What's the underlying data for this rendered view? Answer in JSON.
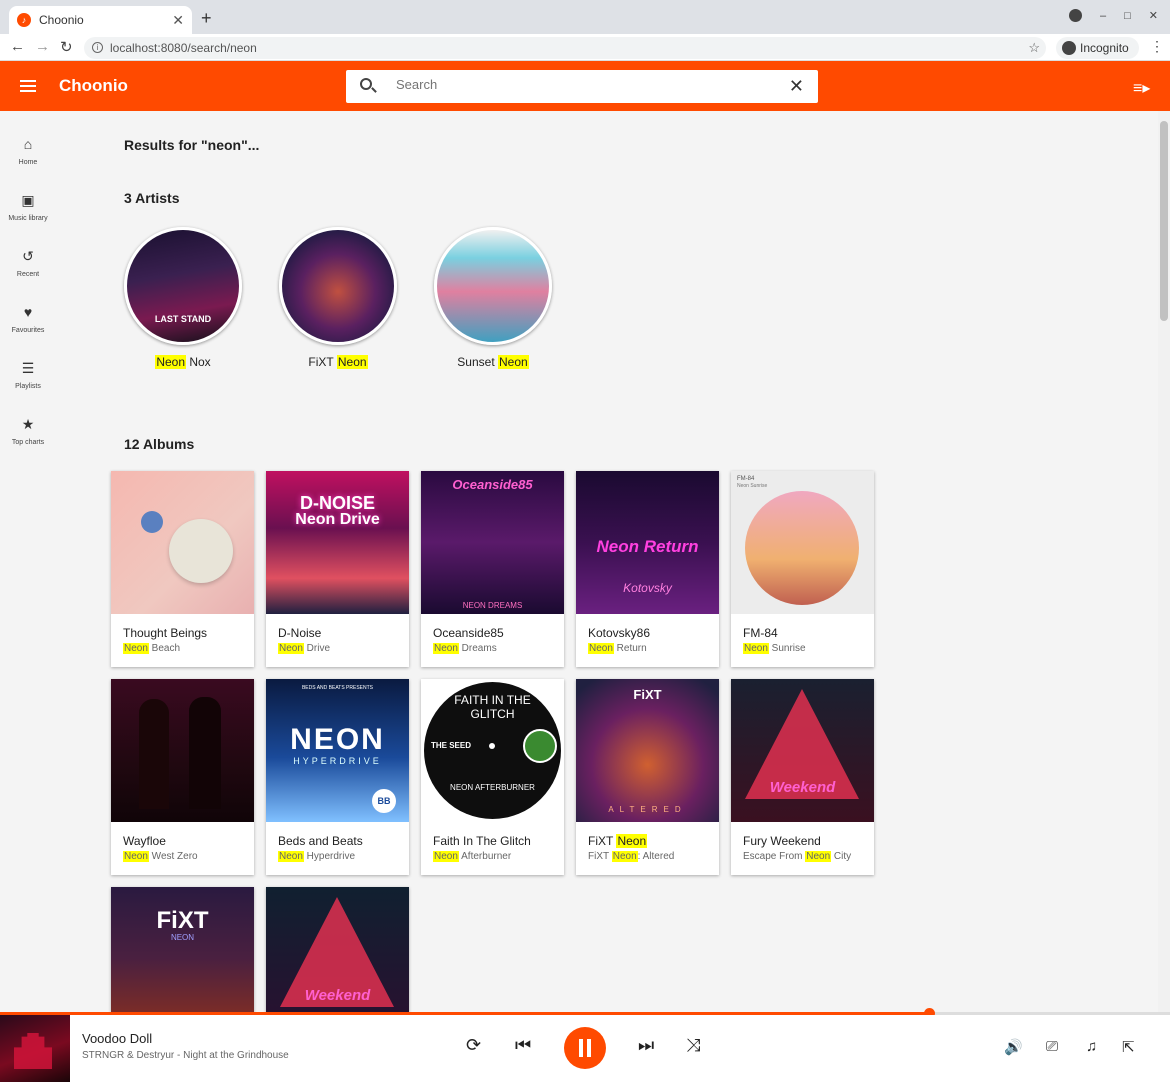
{
  "browser": {
    "tab_title": "Choonio",
    "new_tab": "+",
    "url": "localhost:8080/search/neon",
    "profile": "Incognito"
  },
  "app": {
    "brand": "Choonio",
    "search_placeholder": "Search",
    "accent": "#ff4a00"
  },
  "sidebar": {
    "items": [
      {
        "label": "Home",
        "icon": "home-icon",
        "glyph": "⌂"
      },
      {
        "label": "Music library",
        "icon": "library-icon",
        "glyph": "▣"
      },
      {
        "label": "Recent",
        "icon": "history-icon",
        "glyph": "↺"
      },
      {
        "label": "Favourites",
        "icon": "heart-icon",
        "glyph": "♥"
      },
      {
        "label": "Playlists",
        "icon": "list-icon",
        "glyph": "☰"
      },
      {
        "label": "Top charts",
        "icon": "star-icon",
        "glyph": "★"
      }
    ]
  },
  "search": {
    "results_title": "Results for \"neon\"...",
    "artists_title": "3 Artists",
    "albums_title": "12 Albums"
  },
  "artists": [
    {
      "pre": "",
      "hl": "Neon",
      "post": " Nox"
    },
    {
      "pre": "FiXT ",
      "hl": "Neon",
      "post": ""
    },
    {
      "pre": "Sunset ",
      "hl": "Neon",
      "post": ""
    }
  ],
  "albums": [
    {
      "artist_pre": "Thought Beings",
      "artist_hl": "",
      "artist_post": "",
      "title_pre": "",
      "title_hl": "Neon",
      "title_post": " Beach"
    },
    {
      "artist_pre": "D-Noise",
      "artist_hl": "",
      "artist_post": "",
      "title_pre": "",
      "title_hl": "Neon",
      "title_post": " Drive"
    },
    {
      "artist_pre": "Oceanside85",
      "artist_hl": "",
      "artist_post": "",
      "title_pre": "",
      "title_hl": "Neon",
      "title_post": " Dreams"
    },
    {
      "artist_pre": "Kotovsky86",
      "artist_hl": "",
      "artist_post": "",
      "title_pre": "",
      "title_hl": "Neon",
      "title_post": " Return"
    },
    {
      "artist_pre": "FM-84",
      "artist_hl": "",
      "artist_post": "",
      "title_pre": "",
      "title_hl": "Neon",
      "title_post": " Sunrise"
    },
    {
      "artist_pre": "Wayfloe",
      "artist_hl": "",
      "artist_post": "",
      "title_pre": "",
      "title_hl": "Neon",
      "title_post": " West Zero"
    },
    {
      "artist_pre": "Beds and Beats",
      "artist_hl": "",
      "artist_post": "",
      "title_pre": "",
      "title_hl": "Neon",
      "title_post": " Hyperdrive"
    },
    {
      "artist_pre": "Faith In The Glitch",
      "artist_hl": "",
      "artist_post": "",
      "title_pre": "",
      "title_hl": "Neon",
      "title_post": " Afterburner"
    },
    {
      "artist_pre": "FiXT ",
      "artist_hl": "Neon",
      "artist_post": "",
      "title_pre": "FiXT ",
      "title_hl": "Neon",
      "title_post": ": Altered"
    },
    {
      "artist_pre": "Fury Weekend",
      "artist_hl": "",
      "artist_post": "",
      "title_pre": "Escape From ",
      "title_hl": "Neon",
      "title_post": " City"
    },
    {
      "artist_pre": "",
      "artist_hl": "",
      "artist_post": "",
      "title_pre": "",
      "title_hl": "",
      "title_post": ""
    },
    {
      "artist_pre": "",
      "artist_hl": "",
      "artist_post": "",
      "title_pre": "",
      "title_hl": "",
      "title_post": ""
    }
  ],
  "album_art_text": {
    "dnoise": "D-NOISE",
    "dnoise2": "Neon Drive",
    "oceanside": "Oceanside85",
    "oceanside2": "NEON DREAMS",
    "kotovsky": "Neon Return",
    "kotovsky2": "Kotovsky",
    "fm84": "FM-84",
    "fm84b": "Neon Sunrise",
    "beds1": "BEDS AND BEATS PRESENTS",
    "beds2": "NEON",
    "beds3": "HYPERDRIVE",
    "beds4": "BB",
    "glitch1": "FAITH IN THE",
    "glitch2": "GLITCH",
    "glitch3": "THE SEED",
    "glitch4": "NEON AFTERBURNER",
    "fixt": "FiXT",
    "fixt_altered": "ALTERED",
    "fixt_neon": "NEON",
    "fury": "Weekend",
    "nox": "LAST STAND"
  },
  "player": {
    "title": "Voodoo Doll",
    "artist": "STRNGR & Destryur",
    "album": "Night at the Grindhouse",
    "separator": " - ",
    "progress": 0.794
  }
}
